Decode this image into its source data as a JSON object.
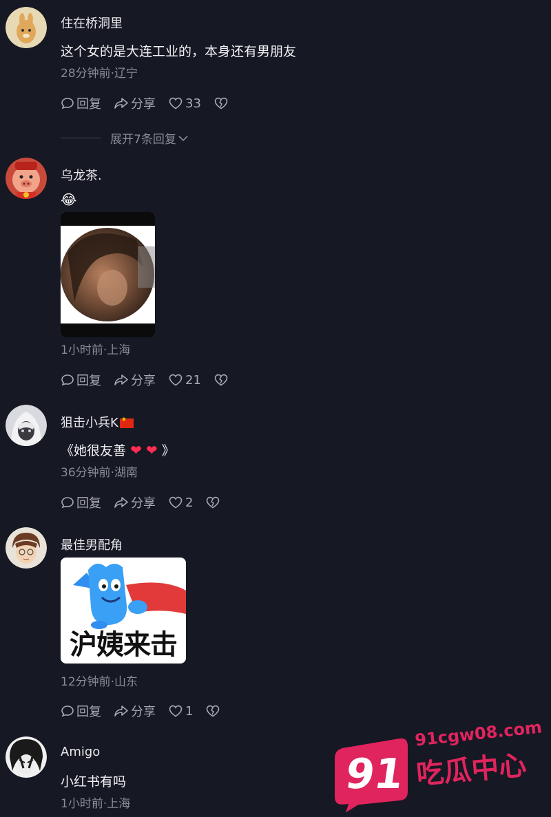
{
  "colors": {
    "background": "#161823",
    "text": "#f2f2f5",
    "meta": "#8a8b93",
    "accent_pink": "#e0245e",
    "heart_red": "#ff2d55"
  },
  "comments": [
    {
      "username": "住在桥洞里",
      "text": "这个女的是大连工业的，本身还有男朋友",
      "meta": "28分钟前·辽宁",
      "reply_label": "回复",
      "share_label": "分享",
      "likes": "33",
      "expand_label": "展开7条回复"
    },
    {
      "username": "乌龙茶.",
      "emoji": "😂",
      "meta": "1小时前·上海",
      "reply_label": "回复",
      "share_label": "分享",
      "likes": "21"
    },
    {
      "username": "狙击小兵K",
      "text_open": "《她很友善",
      "text_close": "》",
      "meta": "36分钟前·湖南",
      "reply_label": "回复",
      "share_label": "分享",
      "likes": "2"
    },
    {
      "username": "最佳男配角",
      "sticker_text": "沪姨来击",
      "meta": "12分钟前·山东",
      "reply_label": "回复",
      "share_label": "分享",
      "likes": "1"
    },
    {
      "username": "Amigo",
      "text": "小红书有吗",
      "meta": "1小时前·上海"
    }
  ],
  "watermark": {
    "number": "91",
    "url": "91cgw08.com",
    "name": "吃瓜中心"
  }
}
